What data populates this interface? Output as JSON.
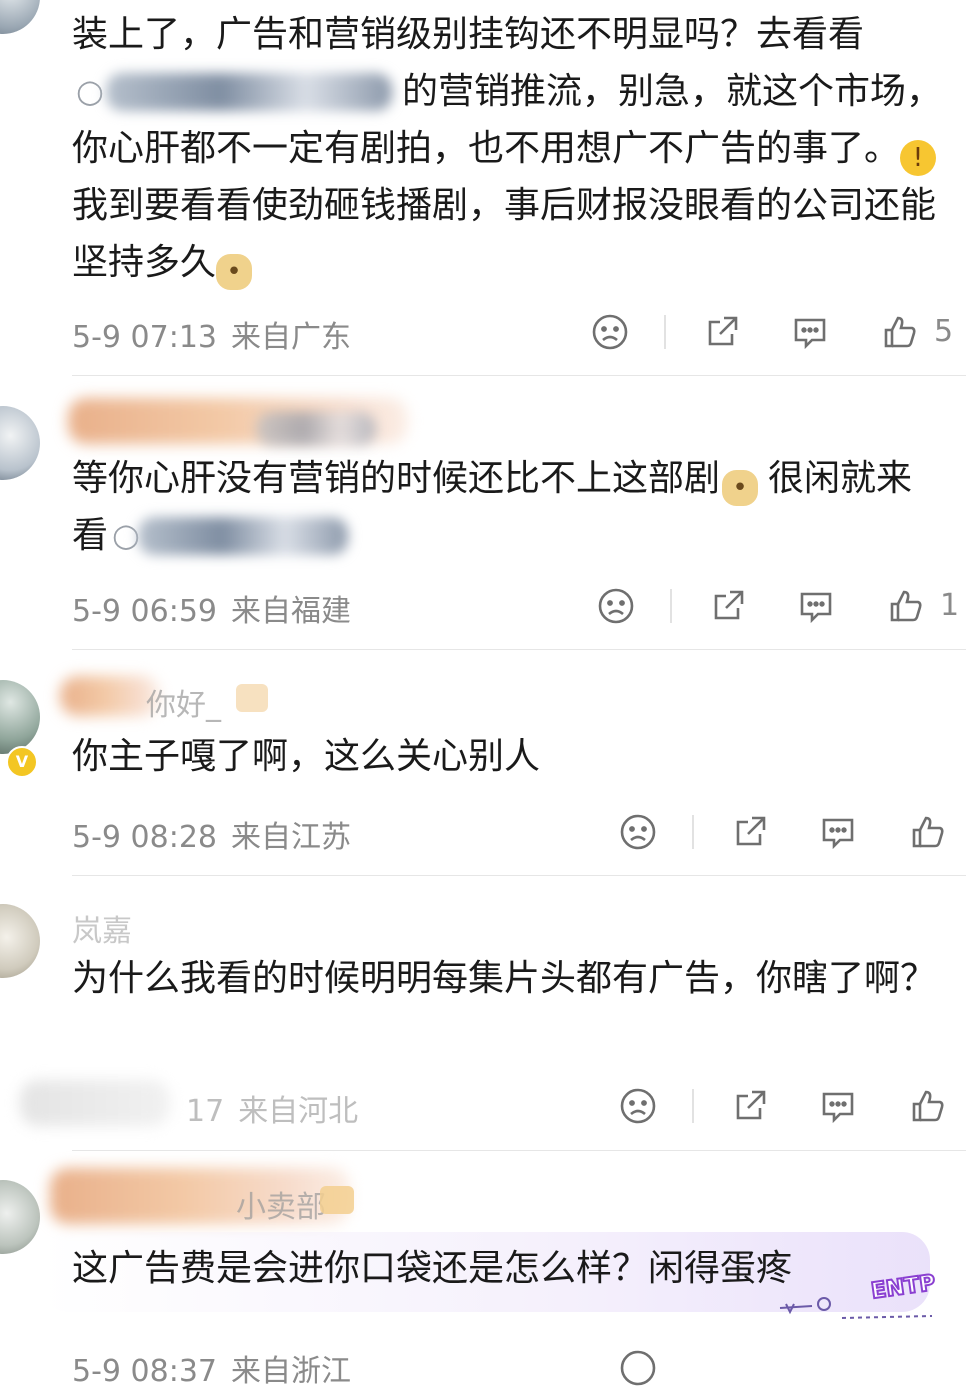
{
  "comments": [
    {
      "text_part1": "装上了，广告和营销级别挂钩还不明显吗？去看看",
      "text_part2": "的营销推流，别急，就这个市场，你心肝都不一定有剧拍，也不用想广不广告的事了。",
      "text_part3": "我到要看看使劲砸钱播剧，事后财报没眼看的公司还能坚持多久",
      "time": "5-9 07:13",
      "location": "来自广东",
      "likes": "5"
    },
    {
      "text_part1": "等你心肝没有营销的时候还比不上这部剧",
      "text_part2": "很闲就来看",
      "time": "5-9 06:59",
      "location": "来自福建",
      "likes": "1"
    },
    {
      "username_suffix": "你好_",
      "text": "你主子嘎了啊，这么关心别人",
      "time": "5-9 08:28",
      "location": "来自江苏",
      "likes": ""
    },
    {
      "username": "岚嘉",
      "text": "为什么我看的时候明明每集片头都有广告，你瞎了啊？",
      "time_partial": "17",
      "location": "来自河北",
      "likes": ""
    },
    {
      "username_suffix": "小卖部",
      "text": "这广告费是会进你口袋还是怎么样？闲得蛋疼",
      "time": "5-9 08:37",
      "location": "来自浙江"
    }
  ],
  "icons": {
    "dislike": "frown-face-icon",
    "share": "share-icon",
    "reply": "comment-icon",
    "like": "thumbs-up-icon",
    "verified": "v-badge-icon"
  },
  "watermark": {
    "text": "ENTP"
  },
  "colors": {
    "text": "#1a1a1a",
    "meta": "#8a8a8a",
    "icon": "#6f6f6f",
    "divider": "#e6e6e6",
    "badge": "#f3c623"
  }
}
